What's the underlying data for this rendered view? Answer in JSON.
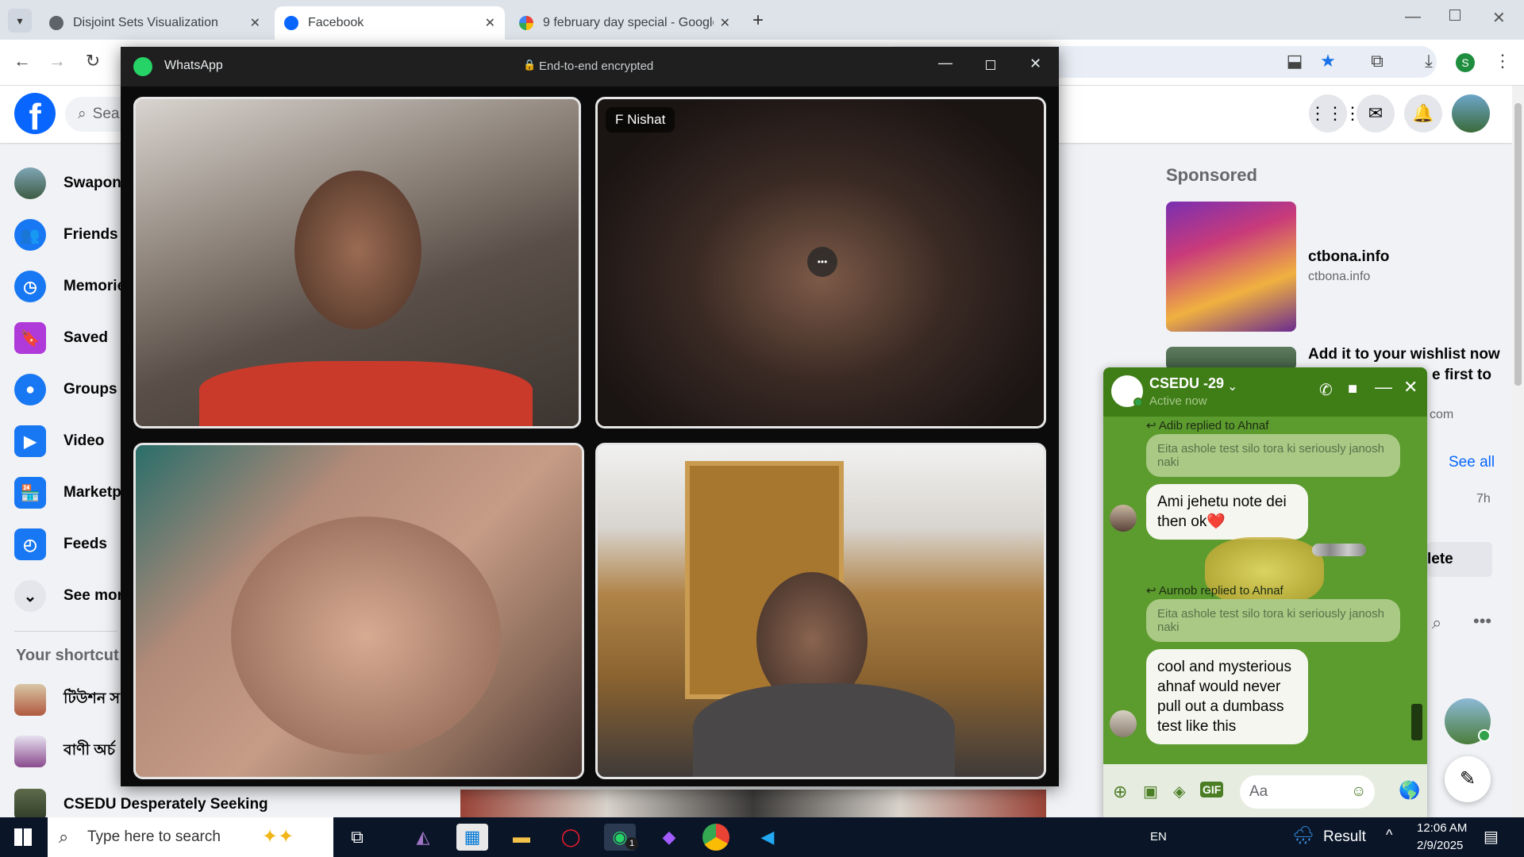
{
  "browser": {
    "tabs": [
      {
        "title": "Disjoint Sets Visualization"
      },
      {
        "title": "Facebook"
      },
      {
        "title": "9 february day special - Google"
      }
    ],
    "new_tab": "+",
    "profile_initial": "S"
  },
  "facebook": {
    "logo": "f",
    "search_placeholder": "Sea",
    "sidebar": [
      {
        "label": "Swapon",
        "icon": "avatar"
      },
      {
        "label": "Friends",
        "icon": "friends-icon"
      },
      {
        "label": "Memorie",
        "icon": "memories-icon"
      },
      {
        "label": "Saved",
        "icon": "saved-icon"
      },
      {
        "label": "Groups",
        "icon": "groups-icon"
      },
      {
        "label": "Video",
        "icon": "video-icon"
      },
      {
        "label": "Marketp",
        "icon": "marketplace-icon"
      },
      {
        "label": "Feeds",
        "icon": "feeds-icon"
      },
      {
        "label": "See mor",
        "icon": "chevron-down-icon"
      }
    ],
    "shortcuts_heading": "Your shortcut",
    "shortcuts": [
      {
        "label": "টিউশন স"
      },
      {
        "label": "বাণী অর্চ"
      },
      {
        "label": "CSEDU Desperately Seeking"
      }
    ],
    "sponsored": {
      "heading": "Sponsored",
      "ad1": {
        "title": "ctbona.info",
        "domain": "ctbona.info"
      },
      "ad2": {
        "title_line1": "Add it to your wishlist now",
        "title_line2": "e first to",
        "domain": "com"
      }
    },
    "right_panel": {
      "see_all": "See all",
      "time": "7h",
      "delete": "lete"
    }
  },
  "whatsapp": {
    "app_name": "WhatsApp",
    "encryption": "End-to-end encrypted",
    "participants": [
      {
        "name": ""
      },
      {
        "name": "F Nishat"
      },
      {
        "name": ""
      },
      {
        "name": ""
      }
    ],
    "more": "•••"
  },
  "messenger": {
    "chat_name": "CSEDU -29",
    "status": "Active now",
    "messages": [
      {
        "reply_tag": "Adib replied to Ahnaf",
        "quoted": "Eita ashole test silo tora ki seriously janosh naki",
        "text_line1": "Ami jehetu note dei",
        "text_line2": "then ok❤️"
      },
      {
        "reply_tag": "Aurnob replied to Ahnaf",
        "quoted": "Eita ashole test silo tora ki seriously janosh naki",
        "text": "cool and mysterious ahnaf would never pull out a dumbass test like this"
      }
    ],
    "input_placeholder": "Aa"
  },
  "taskbar": {
    "search_placeholder": "Type here to search",
    "language": "EN",
    "weather": "Result",
    "time": "12:06 AM",
    "date": "2/9/2025",
    "whatsapp_badge": "1"
  }
}
